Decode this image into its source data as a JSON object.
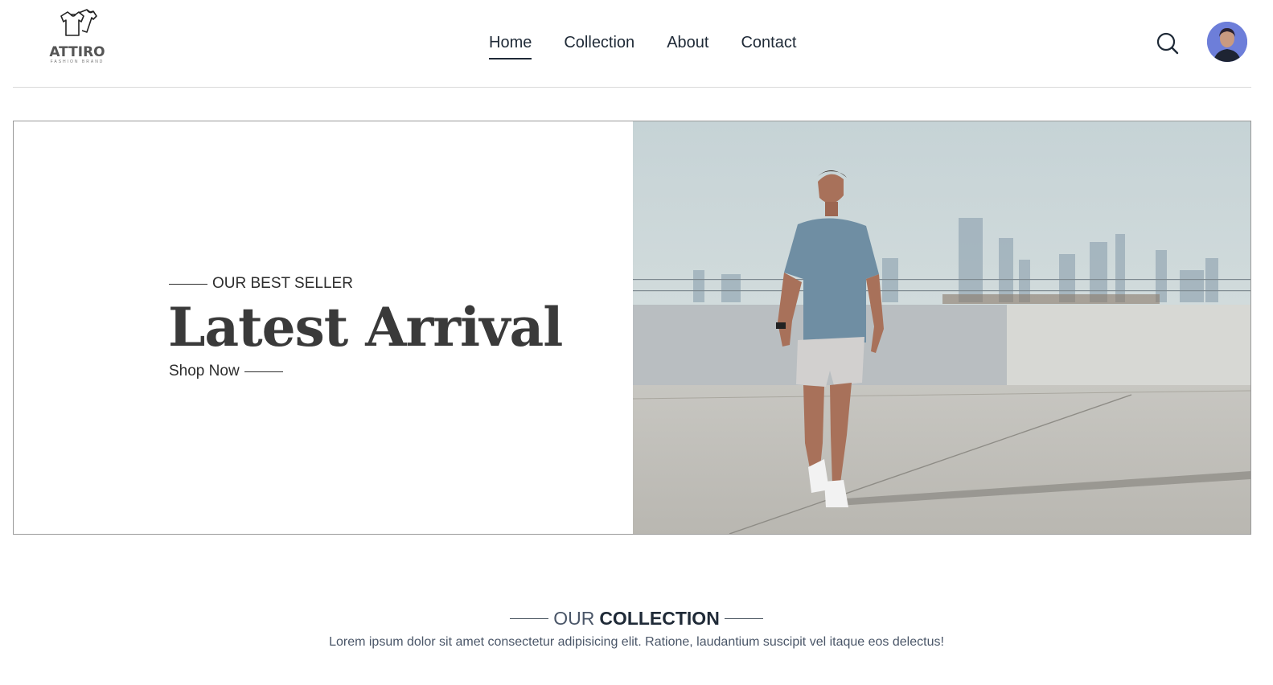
{
  "brand": {
    "name": "ATTIRO",
    "tagline": "FASHION BRAND"
  },
  "nav": {
    "items": [
      {
        "label": "Home",
        "active": true
      },
      {
        "label": "Collection",
        "active": false
      },
      {
        "label": "About",
        "active": false
      },
      {
        "label": "Contact",
        "active": false
      }
    ]
  },
  "header": {
    "search_icon": "search-icon",
    "avatar": "user-avatar"
  },
  "hero": {
    "eyebrow": "OUR BEST SELLER",
    "title": "Latest Arrival",
    "cta": "Shop Now",
    "image": "man-in-blue-tshirt-walking-on-rooftop"
  },
  "collection": {
    "title_light": "OUR",
    "title_bold": "COLLECTION",
    "description": "Lorem ipsum dolor sit amet consectetur adipisicing elit. Ratione, laudantium suscipit vel itaque eos delectus!"
  },
  "colors": {
    "text_dark": "#1f2a37",
    "text_muted": "#4a5668",
    "avatar_bg": "#6d7ed9",
    "shirt": "#6f8ea3"
  }
}
